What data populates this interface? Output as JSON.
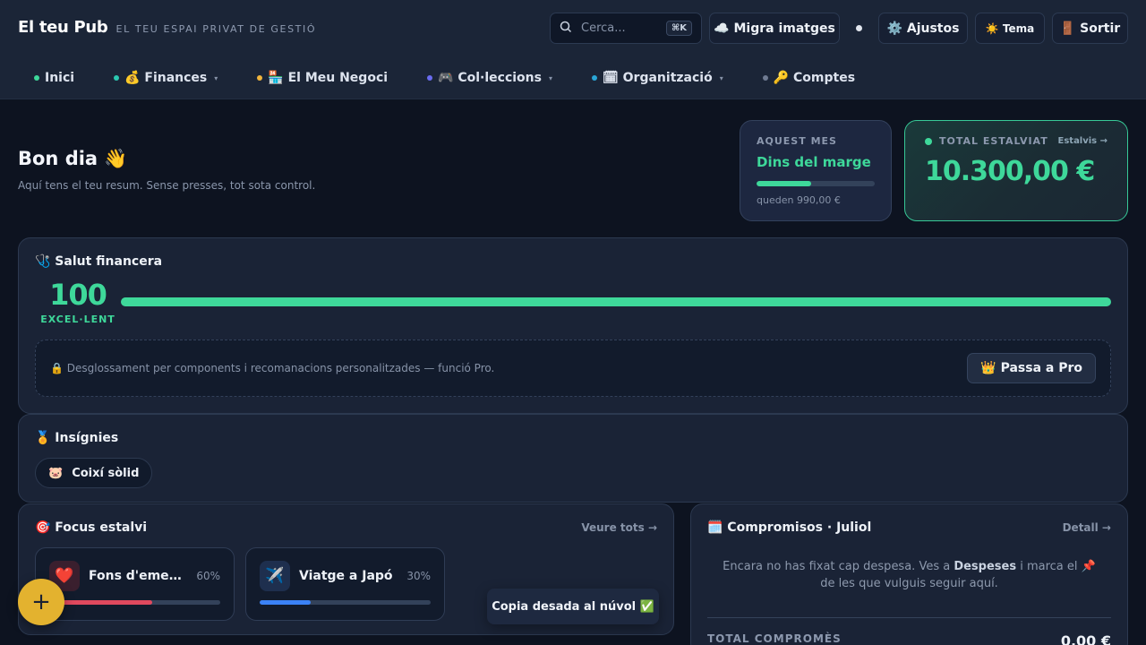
{
  "brand": {
    "title": "El teu Pub",
    "tagline": "EL TEU ESPAI PRIVAT DE GESTIÓ"
  },
  "header": {
    "search_placeholder": "Cerca...",
    "search_shortcut": "⌘K",
    "migrate_label": "☁️ Migra imatges",
    "settings_label": "⚙️ Ajustos",
    "theme_label": "☀️ Tema",
    "logout_label": "🚪 Sortir"
  },
  "nav": {
    "items": [
      {
        "label": "Inici",
        "dot": "#3ed89a",
        "caret": ""
      },
      {
        "label": "💰 Finances",
        "dot": "#2bc7b0",
        "caret": "▾"
      },
      {
        "label": "🏪 El Meu Negoci",
        "dot": "#f1b53d",
        "caret": ""
      },
      {
        "label": "🎮 Col·leccions",
        "dot": "#6a6cf0",
        "caret": "▾"
      },
      {
        "label": "🗓 Organització",
        "dot": "#2aa6d6",
        "caret": "▾"
      },
      {
        "label": "🔑 Comptes",
        "dot": "#6f7b92",
        "caret": ""
      }
    ]
  },
  "hero": {
    "title": "Bon dia 👋",
    "subtitle": "Aquí tens el teu resum. Sense presses, tot sota control."
  },
  "month": {
    "caption": "AQUEST MES",
    "status": "Dins del marge",
    "progress": 0.46,
    "remaining": "queden 990,00 €"
  },
  "saved": {
    "caption": "TOTAL ESTALVIAT",
    "link": "Estalvis →",
    "amount": "10.300,00 €"
  },
  "health": {
    "title": "🩺 Salut financera",
    "score": "100",
    "score_label": "EXCEL·LENT",
    "score_fraction": 1.0,
    "pro_text": "🔒 Desglossament per components i recomanacions personalitzades — funció Pro.",
    "pro_button": "👑 Passa a Pro"
  },
  "badges": {
    "title": "🏅 Insígnies",
    "items": [
      {
        "icon": "🐷",
        "label": "Coixí sòlid"
      }
    ]
  },
  "focus": {
    "title": "🎯 Focus estalvi",
    "link": "Veure tots →",
    "goals": [
      {
        "icon": "❤️",
        "name": "Fons d'emergè...",
        "pct": "60%",
        "progress": 0.6,
        "color": "#e0495e",
        "icon_bg": "#3a1f2e"
      },
      {
        "icon": "✈️",
        "name": "Viatge a Japó",
        "pct": "30%",
        "progress": 0.3,
        "color": "#3b82f6",
        "icon_bg": "#1e2f4e"
      }
    ]
  },
  "commitments": {
    "title": "🗓️ Compromisos · Juliol",
    "link": "Detall →",
    "empty_pre": "Encara no has fixat cap despesa. Ves a ",
    "empty_bold": "Despeses",
    "empty_post": " i marca el 📌 de les que vulguis seguir aquí.",
    "total_caption": "TOTAL COMPROMÈS",
    "total_value": "0,00 €"
  },
  "toast": {
    "text": "Copia desada al núvol ✅"
  },
  "fab": {
    "label": "+"
  }
}
